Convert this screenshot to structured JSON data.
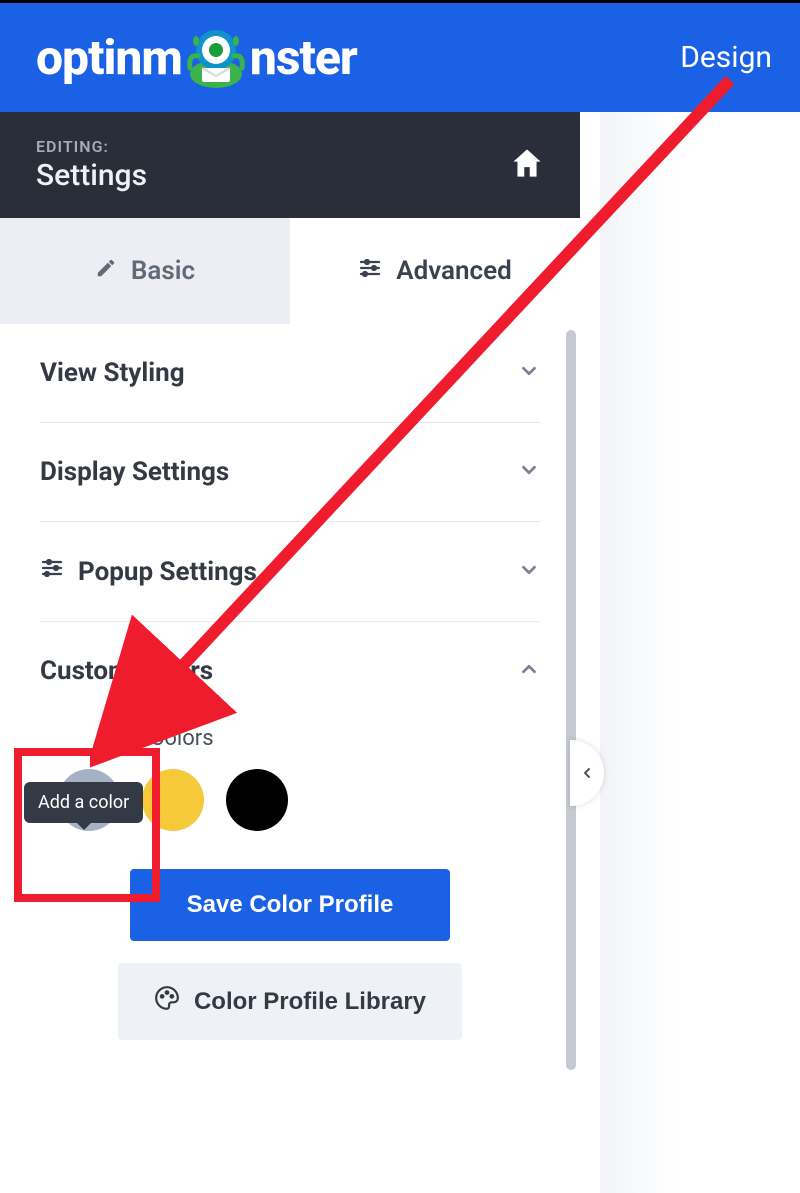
{
  "header": {
    "brand_prefix": "optinm",
    "brand_suffix": "nster",
    "nav_item": "Design"
  },
  "edit_header": {
    "eyebrow": "EDITING:",
    "title": "Settings"
  },
  "tabs": {
    "basic": "Basic",
    "advanced": "Advanced"
  },
  "sections": {
    "view_styling": "View Styling",
    "display_settings": "Display Settings",
    "popup_settings": "Popup Settings",
    "custom_colors": "Custom Colors"
  },
  "custom_colors": {
    "sub_label": "Colors",
    "tooltip": "Add a color",
    "swatches": [
      {
        "name": "yellow",
        "hex": "#f6c93b"
      },
      {
        "name": "black",
        "hex": "#000000"
      }
    ]
  },
  "buttons": {
    "save_profile": "Save Color Profile",
    "profile_library": "Color Profile Library"
  },
  "colors": {
    "brand": "#1a61e6",
    "dark_panel": "#2a2e38",
    "annotation": "#ef1c2e"
  }
}
